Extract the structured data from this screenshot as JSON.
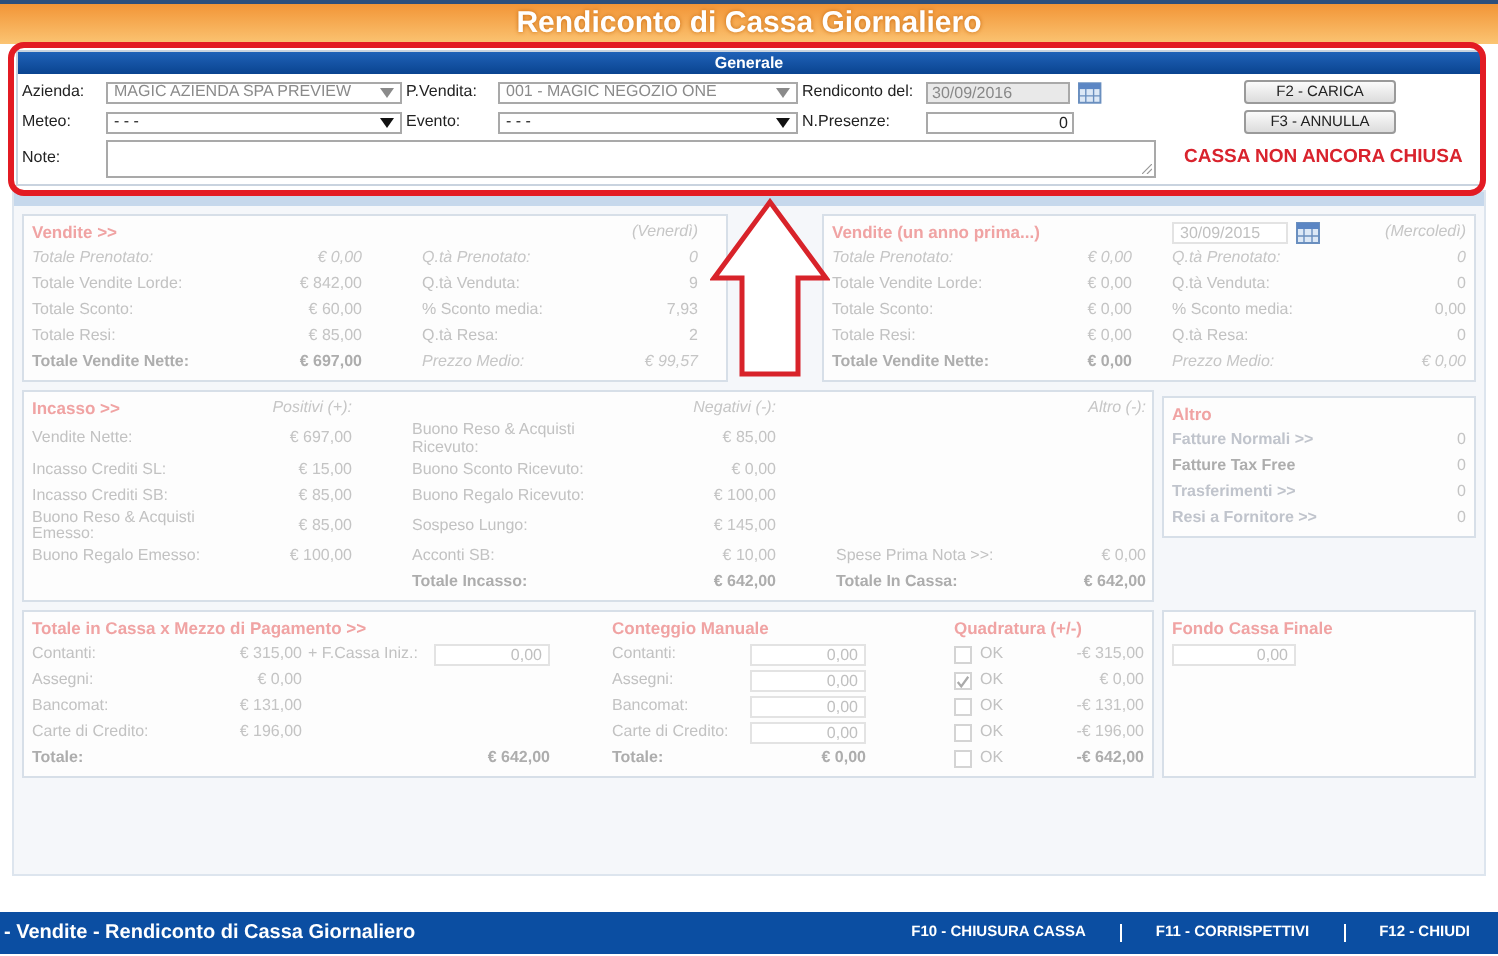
{
  "title": "Rendiconto di Cassa Giornaliero",
  "generale": {
    "header": "Generale",
    "rows": [
      [
        {
          "kind": "label",
          "text": "Azienda:"
        },
        {
          "kind": "select",
          "value": "MAGIC AZIENDA SPA PREVIEW",
          "disabled": true
        },
        {
          "kind": "label",
          "text": "P.Vendita:"
        },
        {
          "kind": "select",
          "value": "001 - MAGIC NEGOZIO ONE",
          "disabled": true
        },
        {
          "kind": "label",
          "text": "Rendiconto del:"
        },
        {
          "kind": "date",
          "value": "30/09/2016",
          "disabled": true
        },
        {
          "kind": "button",
          "text": "F2 - CARICA"
        }
      ],
      [
        {
          "kind": "label",
          "text": "Meteo:"
        },
        {
          "kind": "select",
          "value": "- - -",
          "disabled": false
        },
        {
          "kind": "label",
          "text": "Evento:"
        },
        {
          "kind": "select",
          "value": "- - -",
          "disabled": false
        },
        {
          "kind": "label",
          "text": "N.Presenze:"
        },
        {
          "kind": "input",
          "value": "0",
          "disabled": false
        },
        {
          "kind": "button",
          "text": "F3 - ANNULLA"
        }
      ]
    ],
    "note_label": "Note:",
    "status": "CASSA NON ANCORA CHIUSA"
  },
  "vendite": {
    "rows": [
      [
        {
          "kind": "heading",
          "text": "Vendite >>"
        },
        {
          "kind": "gap"
        },
        {
          "kind": "gap"
        },
        {
          "kind": "gap"
        },
        {
          "kind": "hint-value",
          "text": "(Venerdì)"
        }
      ],
      [
        {
          "kind": "hint",
          "text": "Totale Prenotato:"
        },
        {
          "kind": "hint-value",
          "text": "€ 0,00"
        },
        {
          "kind": "gap"
        },
        {
          "kind": "hint",
          "text": "Q.tà Prenotato:"
        },
        {
          "kind": "hint-value",
          "text": "0"
        }
      ],
      [
        {
          "kind": "label",
          "text": "Totale Vendite Lorde:"
        },
        {
          "kind": "value",
          "text": "€ 842,00"
        },
        {
          "kind": "gap"
        },
        {
          "kind": "label",
          "text": "Q.tà Venduta:"
        },
        {
          "kind": "value",
          "text": "9"
        }
      ],
      [
        {
          "kind": "label",
          "text": "Totale Sconto:"
        },
        {
          "kind": "value",
          "text": "€ 60,00"
        },
        {
          "kind": "gap"
        },
        {
          "kind": "label",
          "text": "% Sconto media:"
        },
        {
          "kind": "value",
          "text": "7,93"
        }
      ],
      [
        {
          "kind": "label",
          "text": "Totale Resi:"
        },
        {
          "kind": "value",
          "text": "€ 85,00"
        },
        {
          "kind": "gap"
        },
        {
          "kind": "label",
          "text": "Q.tà Resa:"
        },
        {
          "kind": "value",
          "text": "2"
        }
      ],
      [
        {
          "kind": "total",
          "text": "Totale Vendite Nette:"
        },
        {
          "kind": "total-value",
          "text": "€ 697,00"
        },
        {
          "kind": "gap"
        },
        {
          "kind": "hint",
          "text": "Prezzo Medio:"
        },
        {
          "kind": "hint-value",
          "text": "€ 99,57"
        }
      ]
    ]
  },
  "vendite_anno_prima": {
    "rows": [
      [
        {
          "kind": "heading",
          "text": "Vendite (un anno prima...)"
        },
        {
          "kind": "gap"
        },
        {
          "kind": "gap"
        },
        {
          "kind": "date",
          "value": "30/09/2015"
        },
        {
          "kind": "hint-value",
          "text": "(Mercoledì)"
        }
      ],
      [
        {
          "kind": "hint",
          "text": "Totale Prenotato:"
        },
        {
          "kind": "hint-value",
          "text": "€ 0,00"
        },
        {
          "kind": "gap"
        },
        {
          "kind": "hint",
          "text": "Q.tà Prenotato:"
        },
        {
          "kind": "hint-value",
          "text": "0"
        }
      ],
      [
        {
          "kind": "label",
          "text": "Totale Vendite Lorde:"
        },
        {
          "kind": "value",
          "text": "€ 0,00"
        },
        {
          "kind": "gap"
        },
        {
          "kind": "label",
          "text": "Q.tà Venduta:"
        },
        {
          "kind": "value",
          "text": "0"
        }
      ],
      [
        {
          "kind": "label",
          "text": "Totale Sconto:"
        },
        {
          "kind": "value",
          "text": "€ 0,00"
        },
        {
          "kind": "gap"
        },
        {
          "kind": "label",
          "text": "% Sconto media:"
        },
        {
          "kind": "value",
          "text": "0,00"
        }
      ],
      [
        {
          "kind": "label",
          "text": "Totale Resi:"
        },
        {
          "kind": "value",
          "text": "€ 0,00"
        },
        {
          "kind": "gap"
        },
        {
          "kind": "label",
          "text": "Q.tà Resa:"
        },
        {
          "kind": "value",
          "text": "0"
        }
      ],
      [
        {
          "kind": "total",
          "text": "Totale Vendite Nette:"
        },
        {
          "kind": "total-value",
          "text": "€ 0,00"
        },
        {
          "kind": "gap"
        },
        {
          "kind": "hint",
          "text": "Prezzo Medio:"
        },
        {
          "kind": "hint-value",
          "text": "€ 0,00"
        }
      ]
    ]
  },
  "incasso": {
    "rows": [
      [
        {
          "kind": "heading",
          "text": "Incasso >>"
        },
        {
          "kind": "hint-value",
          "text": "Positivi (+):"
        },
        {
          "kind": "gap"
        },
        {
          "kind": "gap"
        },
        {
          "kind": "hint-value",
          "text": "Negativi (-):"
        },
        {
          "kind": "gap"
        },
        {
          "kind": "gap"
        },
        {
          "kind": "hint-value",
          "text": "Altro (-):"
        }
      ],
      [
        {
          "kind": "label",
          "text": "Vendite Nette:"
        },
        {
          "kind": "value",
          "text": "€ 697,00"
        },
        {
          "kind": "gap"
        },
        {
          "kind": "label",
          "text": "Buono Reso & Acquisti Ricevuto:"
        },
        {
          "kind": "value",
          "text": "€ 85,00"
        }
      ],
      [
        {
          "kind": "label",
          "text": "Incasso Crediti SL:"
        },
        {
          "kind": "value",
          "text": "€ 15,00"
        },
        {
          "kind": "gap"
        },
        {
          "kind": "label",
          "text": "Buono Sconto Ricevuto:"
        },
        {
          "kind": "value",
          "text": "€ 0,00"
        }
      ],
      [
        {
          "kind": "label",
          "text": "Incasso Crediti SB:"
        },
        {
          "kind": "value",
          "text": "€ 85,00"
        },
        {
          "kind": "gap"
        },
        {
          "kind": "label",
          "text": "Buono Regalo Ricevuto:"
        },
        {
          "kind": "value",
          "text": "€ 100,00"
        }
      ],
      [
        {
          "kind": "label",
          "text": "Buono Reso & Acquisti Emesso:"
        },
        {
          "kind": "value",
          "text": "€ 85,00"
        },
        {
          "kind": "gap"
        },
        {
          "kind": "label",
          "text": "Sospeso Lungo:"
        },
        {
          "kind": "value",
          "text": "€ 145,00"
        }
      ],
      [
        {
          "kind": "label",
          "text": "Buono Regalo Emesso:"
        },
        {
          "kind": "value",
          "text": "€ 100,00"
        },
        {
          "kind": "gap"
        },
        {
          "kind": "label",
          "text": "Acconti SB:"
        },
        {
          "kind": "value",
          "text": "€ 10,00"
        },
        {
          "kind": "gap"
        },
        {
          "kind": "label",
          "text": "Spese Prima Nota >>:"
        },
        {
          "kind": "value",
          "text": "€ 0,00"
        }
      ],
      [
        {
          "kind": "gap"
        },
        {
          "kind": "gap"
        },
        {
          "kind": "gap"
        },
        {
          "kind": "total",
          "text": "Totale Incasso:"
        },
        {
          "kind": "total-value",
          "text": "€ 642,00"
        },
        {
          "kind": "gap"
        },
        {
          "kind": "total",
          "text": "Totale In Cassa:"
        },
        {
          "kind": "total-value",
          "text": "€ 642,00"
        }
      ]
    ]
  },
  "altro": {
    "rows": [
      [
        {
          "kind": "heading",
          "text": "Altro"
        }
      ],
      [
        {
          "kind": "link",
          "text": "Fatture Normali >>"
        },
        {
          "kind": "value",
          "text": "0"
        }
      ],
      [
        {
          "kind": "total",
          "text": "Fatture Tax Free"
        },
        {
          "kind": "value",
          "text": "0"
        }
      ],
      [
        {
          "kind": "link",
          "text": "Trasferimenti >>"
        },
        {
          "kind": "value",
          "text": "0"
        }
      ],
      [
        {
          "kind": "link",
          "text": "Resi a Fornitore >>"
        },
        {
          "kind": "value",
          "text": "0"
        }
      ]
    ]
  },
  "totale_cassa": {
    "rows": [
      [
        {
          "kind": "heading",
          "text": "Totale in Cassa x Mezzo di Pagamento >>"
        },
        {
          "kind": "gap"
        },
        {
          "kind": "gap"
        },
        {
          "kind": "gap"
        },
        {
          "kind": "gap"
        },
        {
          "kind": "heading",
          "text": "Conteggio Manuale"
        },
        {
          "kind": "gap"
        },
        {
          "kind": "gap"
        },
        {
          "kind": "heading",
          "text": "Quadratura (+/-)"
        },
        {
          "kind": "gap"
        }
      ],
      [
        {
          "kind": "label",
          "text": "Contanti:"
        },
        {
          "kind": "value",
          "text": "€ 315,00"
        },
        {
          "kind": "label",
          "text": "+ F.Cassa Iniz.:"
        },
        {
          "kind": "field",
          "value": "0,00"
        },
        {
          "kind": "gap"
        },
        {
          "kind": "label",
          "text": "Contanti:"
        },
        {
          "kind": "field",
          "value": "0,00"
        },
        {
          "kind": "gap"
        },
        {
          "kind": "check",
          "text": "OK",
          "checked": false
        },
        {
          "kind": "value",
          "text": "-€ 315,00"
        }
      ],
      [
        {
          "kind": "label",
          "text": "Assegni:"
        },
        {
          "kind": "value",
          "text": "€ 0,00"
        },
        {
          "kind": "gap"
        },
        {
          "kind": "gap"
        },
        {
          "kind": "gap"
        },
        {
          "kind": "label",
          "text": "Assegni:"
        },
        {
          "kind": "field",
          "value": "0,00"
        },
        {
          "kind": "gap"
        },
        {
          "kind": "check",
          "text": "OK",
          "checked": true
        },
        {
          "kind": "value",
          "text": "€ 0,00"
        }
      ],
      [
        {
          "kind": "label",
          "text": "Bancomat:"
        },
        {
          "kind": "value",
          "text": "€ 131,00"
        },
        {
          "kind": "gap"
        },
        {
          "kind": "gap"
        },
        {
          "kind": "gap"
        },
        {
          "kind": "label",
          "text": "Bancomat:"
        },
        {
          "kind": "field",
          "value": "0,00"
        },
        {
          "kind": "gap"
        },
        {
          "kind": "check",
          "text": "OK",
          "checked": false
        },
        {
          "kind": "value",
          "text": "-€ 131,00"
        }
      ],
      [
        {
          "kind": "label",
          "text": "Carte di Credito:"
        },
        {
          "kind": "value",
          "text": "€ 196,00"
        },
        {
          "kind": "gap"
        },
        {
          "kind": "gap"
        },
        {
          "kind": "gap"
        },
        {
          "kind": "label",
          "text": "Carte di Credito:"
        },
        {
          "kind": "field",
          "value": "0,00"
        },
        {
          "kind": "gap"
        },
        {
          "kind": "check",
          "text": "OK",
          "checked": false
        },
        {
          "kind": "value",
          "text": "-€ 196,00"
        }
      ],
      [
        {
          "kind": "total",
          "text": "Totale:"
        },
        {
          "kind": "gap"
        },
        {
          "kind": "gap"
        },
        {
          "kind": "total-value",
          "text": "€ 642,00"
        },
        {
          "kind": "gap"
        },
        {
          "kind": "total",
          "text": "Totale:"
        },
        {
          "kind": "total-value",
          "text": "€ 0,00"
        },
        {
          "kind": "gap"
        },
        {
          "kind": "check",
          "text": "OK",
          "checked": false
        },
        {
          "kind": "total-value",
          "text": "-€ 642,00"
        }
      ]
    ]
  },
  "fondo_cassa": {
    "rows": [
      [
        {
          "kind": "heading",
          "text": "Fondo Cassa Finale"
        }
      ],
      [
        {
          "kind": "field",
          "value": "0,00"
        }
      ]
    ]
  },
  "footer": {
    "title": "- Vendite - Rendiconto di Cassa Giornaliero",
    "shortcuts": [
      "F10 - CHIUSURA CASSA",
      "F11 - CORRISPETTIVI",
      "F12 - CHIUDI"
    ]
  }
}
